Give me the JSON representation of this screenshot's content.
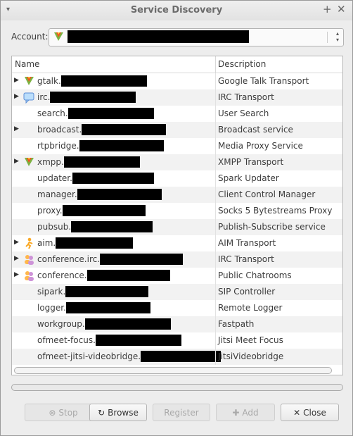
{
  "window": {
    "title": "Service Discovery",
    "menu_glyph": "▾",
    "pin_glyph": "+",
    "close_glyph": "✕"
  },
  "account": {
    "label": "Account:",
    "icon": "google-talk-icon"
  },
  "columns": {
    "name": "Name",
    "description": "Description"
  },
  "rows": [
    {
      "name": "gtalk.",
      "desc": "Google Talk Transport",
      "expand": true,
      "icon": "google-talk-icon"
    },
    {
      "name": "irc.",
      "desc": "IRC Transport",
      "expand": true,
      "icon": "chat-bubble-icon"
    },
    {
      "name": "search.",
      "desc": "User Search",
      "expand": false,
      "icon": ""
    },
    {
      "name": "broadcast.",
      "desc": "Broadcast service",
      "expand": true,
      "icon": ""
    },
    {
      "name": "rtpbridge.",
      "desc": "Media Proxy Service",
      "expand": false,
      "icon": ""
    },
    {
      "name": "xmpp.",
      "desc": "XMPP Transport",
      "expand": true,
      "icon": "google-talk-icon"
    },
    {
      "name": "updater.",
      "desc": "Spark Updater",
      "expand": false,
      "icon": ""
    },
    {
      "name": "manager.",
      "desc": "Client Control Manager",
      "expand": false,
      "icon": ""
    },
    {
      "name": "proxy.",
      "desc": "Socks 5 Bytestreams Proxy",
      "expand": false,
      "icon": ""
    },
    {
      "name": "pubsub.",
      "desc": "Publish-Subscribe service",
      "expand": false,
      "icon": ""
    },
    {
      "name": "aim.",
      "desc": "AIM Transport",
      "expand": true,
      "icon": "aim-running-man-icon"
    },
    {
      "name": "conference.irc.",
      "desc": "IRC Transport",
      "expand": true,
      "icon": "group-chat-icon"
    },
    {
      "name": "conference.",
      "desc": "Public Chatrooms",
      "expand": true,
      "icon": "group-chat-icon"
    },
    {
      "name": "sipark.",
      "desc": "SIP Controller",
      "expand": false,
      "icon": ""
    },
    {
      "name": "logger.",
      "desc": "Remote Logger",
      "expand": false,
      "icon": ""
    },
    {
      "name": "workgroup.",
      "desc": "Fastpath",
      "expand": false,
      "icon": ""
    },
    {
      "name": "ofmeet-focus.",
      "desc": "Jitsi Meet Focus",
      "expand": false,
      "icon": ""
    },
    {
      "name": "ofmeet-jitsi-videobridge.",
      "desc": "JitsiVideobridge",
      "expand": false,
      "icon": ""
    }
  ],
  "buttons": {
    "stop": "Stop",
    "browse": "Browse",
    "register": "Register",
    "add": "Add",
    "close": "Close"
  }
}
